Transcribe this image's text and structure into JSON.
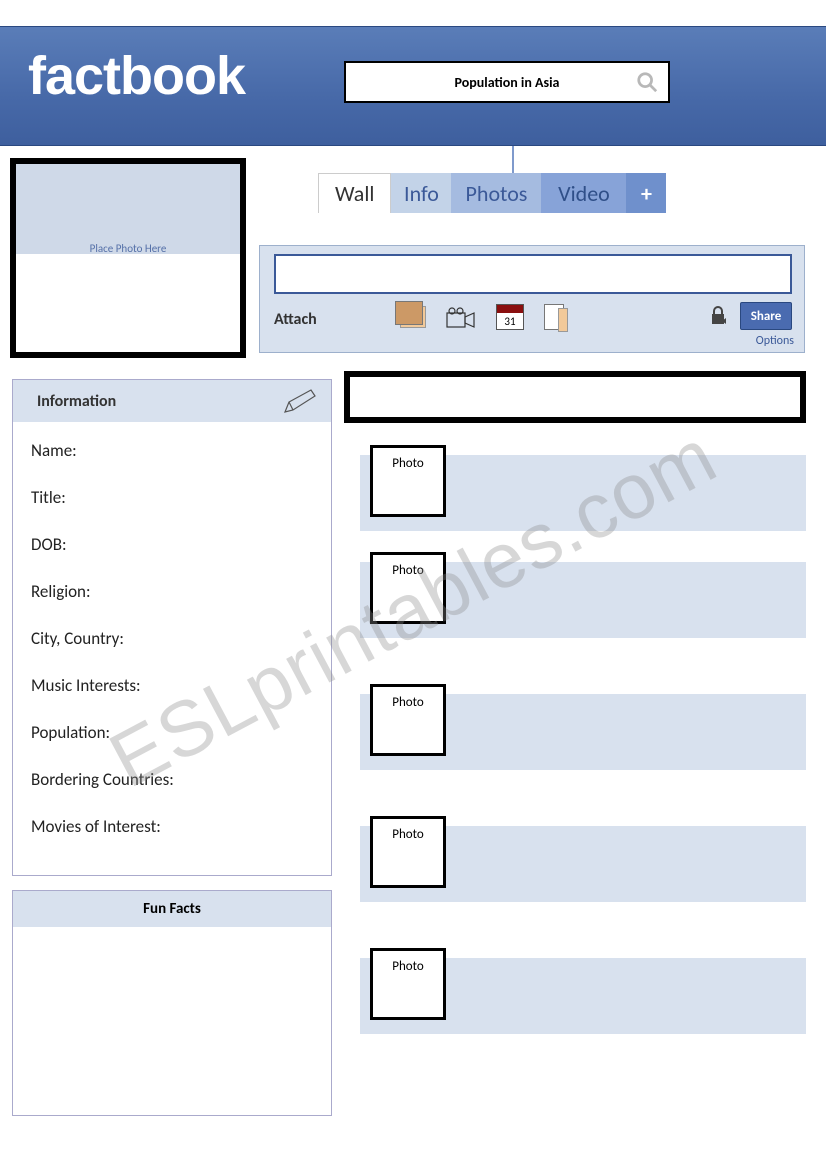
{
  "header": {
    "logo": "factbook",
    "search_text": "Population in Asia"
  },
  "profile": {
    "photo_placeholder": "Place Photo Here"
  },
  "tabs": {
    "wall": "Wall",
    "info": "Info",
    "photos": "Photos",
    "video": "Video",
    "plus": "+"
  },
  "composer": {
    "attach_label": "Attach",
    "calendar_day": "31",
    "share_label": "Share",
    "options_label": "Options"
  },
  "info_panel": {
    "header": "Information",
    "fields": {
      "name": "Name:",
      "title": "Title:",
      "dob": "DOB:",
      "religion": "Religion:",
      "city_country": "City, Country:",
      "music": "Music Interests:",
      "population": "Population:",
      "bordering": "Bordering Countries:",
      "movies": "Movies of Interest:"
    }
  },
  "funfacts": {
    "header": "Fun Facts"
  },
  "posts": {
    "photo_label": "Photo"
  },
  "watermark": "ESLprintables.com"
}
